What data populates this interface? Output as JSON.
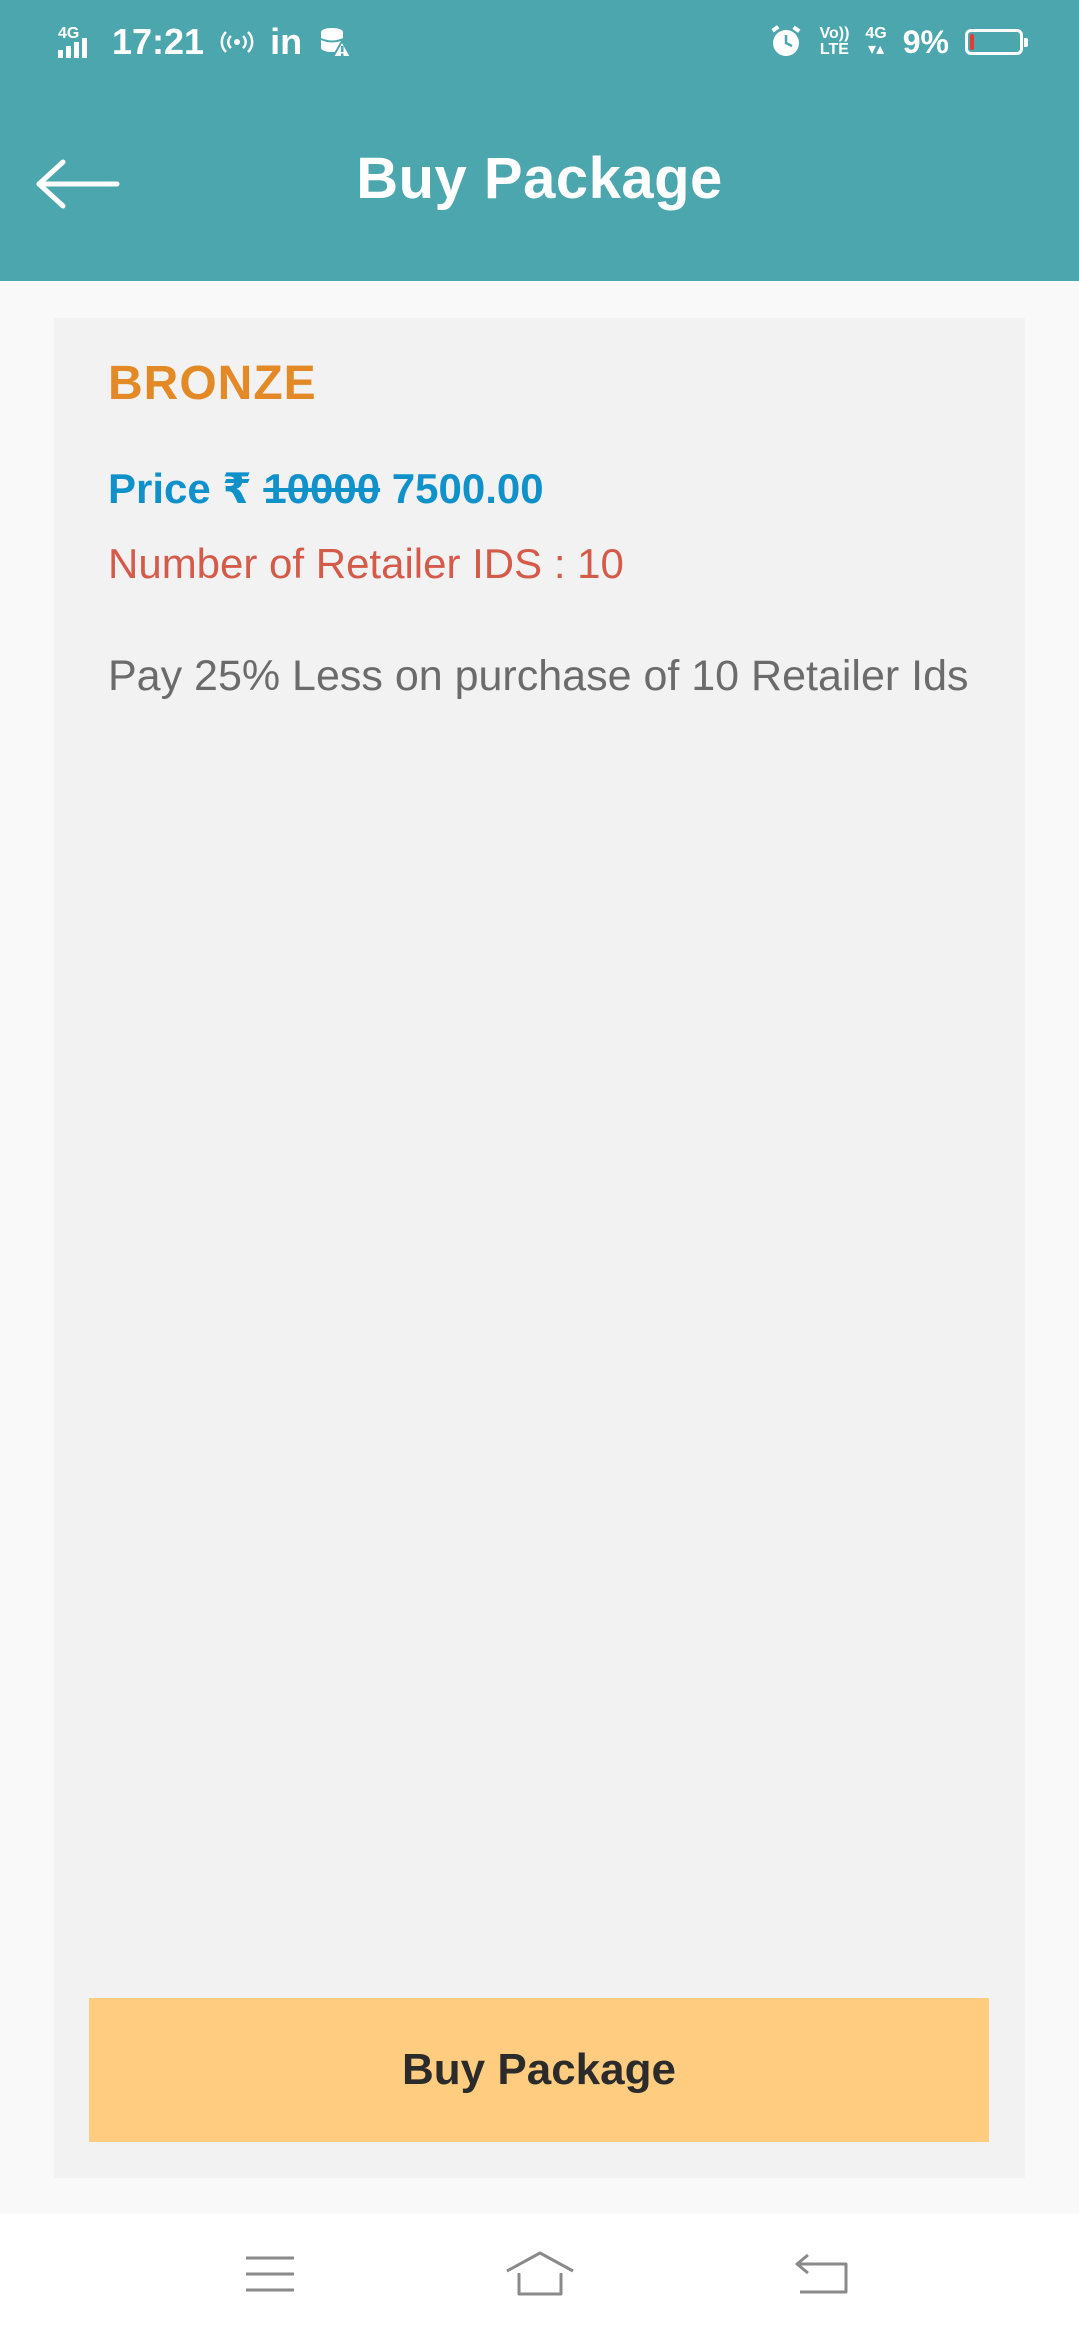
{
  "status_bar": {
    "network_left": "4G",
    "time": "17:21",
    "linkedin": "in",
    "volte_top": "Vo))",
    "volte_bottom": "LTE",
    "network_right": "4G",
    "battery_percent": "9%",
    "battery_level": 0.09
  },
  "header": {
    "title": "Buy Package",
    "background": "#4ca6ad"
  },
  "package": {
    "name": "BRONZE",
    "price_label": "Price ₹",
    "original_price": "10000",
    "discounted_price": "7500.00",
    "retailer_ids": "Number of Retailer IDS : 10",
    "description": "Pay 25% Less on purchase of 10 Retailer Ids"
  },
  "actions": {
    "buy_label": "Buy Package",
    "buy_color": "#ffcc80"
  },
  "icons": {
    "back": "arrow-left-icon",
    "menu": "menu-icon",
    "home": "home-icon",
    "return": "return-icon"
  },
  "colors": {
    "package_name": "#e38a26",
    "price": "#1191ca",
    "retailer": "#d45a4a",
    "description": "#6b6b6b"
  }
}
